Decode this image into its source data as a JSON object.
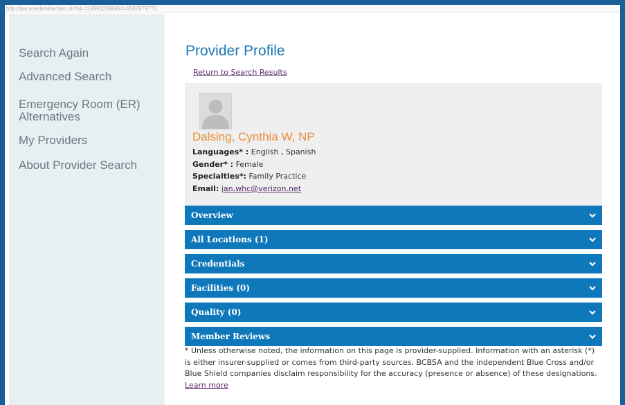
{
  "browser": {
    "url": "http://pscare/detailaction.do?id=1195812086&id=6582979772"
  },
  "sidebar": {
    "items": [
      {
        "label": "Search Again"
      },
      {
        "label": "Advanced Search"
      },
      {
        "label": "Emergency Room (ER) Alternatives"
      },
      {
        "label": "My Providers"
      },
      {
        "label": "About Provider Search"
      }
    ]
  },
  "page": {
    "title": "Provider Profile",
    "return_link": "Return to Search Results"
  },
  "provider": {
    "name": "Dalsing, Cynthia W, NP",
    "languages_label": "Languages* :",
    "languages_value": "English , Spanish",
    "gender_label": "Gender* :",
    "gender_value": "Female",
    "specialties_label": "Specialties*:",
    "specialties_value": "Family Practice",
    "email_label": "Email:",
    "email_value": "jan.whc@verizon.net"
  },
  "sections": [
    {
      "label": "Overview"
    },
    {
      "label": "All Locations (1)"
    },
    {
      "label": "Credentials"
    },
    {
      "label": "Facilities (0)"
    },
    {
      "label": "Quality (0)"
    },
    {
      "label": "Member Reviews"
    }
  ],
  "disclaimer": {
    "text": "* Unless otherwise noted, the information on this page is provider-supplied. Information with an asterisk (*) is either insurer-supplied or comes from third-party sources. BCBSA and the independent Blue Cross and/or Blue Shield companies disclaim responsibility for the accuracy (presence or absence) of these designations.",
    "link": "Learn more"
  },
  "colors": {
    "accordion_bg": "#0f78bb",
    "title": "#1a75b4",
    "provider_name": "#e8903a",
    "sidebar_bg": "#e8eff3",
    "link": "#5a2a68",
    "outer_frame": "#1a5f98"
  }
}
